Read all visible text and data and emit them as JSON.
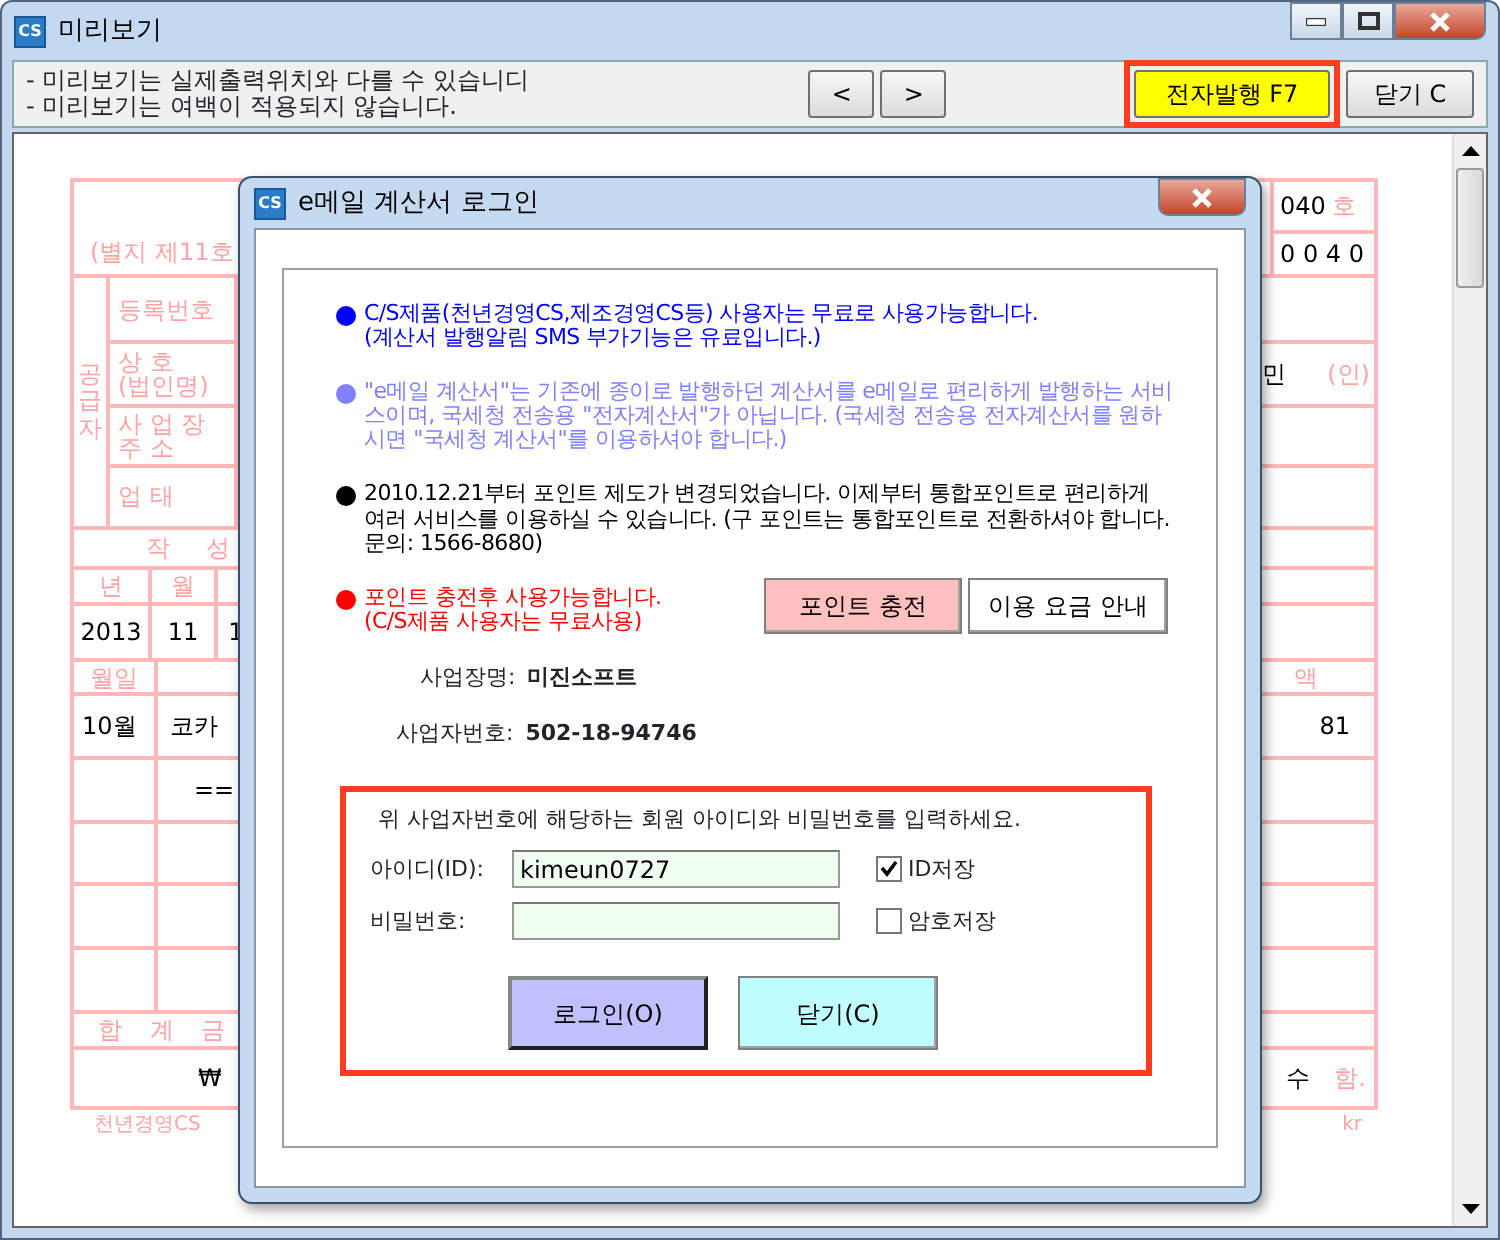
{
  "window": {
    "title": "미리보기",
    "app_icon": "CS"
  },
  "toolbar": {
    "notes": [
      "- 미리보기는 실제출력위치와 다를 수 있습니디",
      "- 미리보기는 여백이 적용되지 않습니다."
    ],
    "prev": "<",
    "next": ">",
    "issue_button": "전자발행 F7",
    "close_button": "닫기 C"
  },
  "invoice": {
    "header": {
      "form_no": "(별지 제11호",
      "serial": "040",
      "serial_suffix": "호",
      "digits": "0 0 4 0"
    },
    "supplier": {
      "label": "공급자",
      "rows": [
        {
          "label": "등록번호"
        },
        {
          "label": "상 호",
          "label2": "(법인명)",
          "value": "민",
          "seal": "(인)"
        },
        {
          "label": "사 업 장",
          "label2": "주 소"
        },
        {
          "label": "업 태"
        }
      ]
    },
    "date_label": "작 성",
    "date_heads": [
      "년",
      "월"
    ],
    "date_values": [
      "2013",
      "11",
      "1"
    ],
    "item_heads": {
      "date": "월일",
      "amount": "액"
    },
    "items": [
      {
        "date": "10월",
        "name": "코카",
        "amount": "81"
      },
      {
        "name": "=="
      }
    ],
    "total_label": "합 계 금",
    "total": {
      "amount": "₩",
      "note": "수",
      "note_suffix": "함."
    },
    "footer": {
      "left": "천년경영CS",
      "right": "kr"
    }
  },
  "dialog": {
    "title": "e메일 계산서 로그인",
    "app_icon": "CS",
    "notices": [
      {
        "color": "#0000ff",
        "text": "C/S제품(천년경영CS,제조경영CS등) 사용자는 무료로 사용가능합니다.\n(계산서 발행알림 SMS 부가기능은 유료입니다.)"
      },
      {
        "color": "#8080ff",
        "text": "\"e메일 계산서\"는 기존에 종이로 발행하던 계산서를 e메일로 편리하게 발행하는 서비스이며, 국세청 전송용 \"전자계산서\"가 아닙니다. (국세청 전송용 전자계산서를 원하시면 \"국세청 계산서\"를 이용하셔야 합니다.)"
      },
      {
        "color": "#000000",
        "text": "2010.12.21부터 포인트 제도가 변경되었습니다. 이제부터 통합포인트로 편리하게  여러 서비스를 이용하실 수 있습니다. (구 포인트는 통합포인트로 전환하셔야 합니다. 문의: 1566-8680)"
      },
      {
        "color": "#ff0000",
        "text": "포인트 충전후 사용가능합니다.\n(C/S제품 사용자는 무료사용)"
      }
    ],
    "charge_button": "포인트 충전",
    "pricing_button": "이용 요금 안내",
    "business_name_label": "사업장명:",
    "business_name": "미진소프트",
    "business_no_label": "사업자번호:",
    "business_no": "502-18-94746",
    "instruction": "위 사업자번호에 해당하는 회원 아이디와 비밀번호를 입력하세요.",
    "id_label": "아이디(ID):",
    "id_value": "kimeun0727",
    "save_id": {
      "label": "ID저장",
      "checked": true
    },
    "password_label": "비밀번호:",
    "save_password": {
      "label": "암호저장",
      "checked": false
    },
    "login_button": "로그인(O)",
    "close_button": "닫기(C)"
  }
}
